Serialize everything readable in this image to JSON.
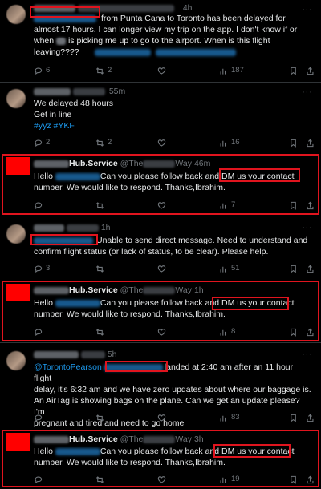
{
  "tweets": [
    {
      "time": "4h",
      "text": "from Punta Cana to Toronto has been delayed for almost 17 hours. I can longer view my trip on the app. I don't know if or when I is picking me up to go to the airport. When is this flight leaving????",
      "line1": "from Punta Cana to Toronto has been delayed for",
      "line2": "almost 17 hours. I can longer view my trip on the app. I don't know if or",
      "line3a": "when",
      "line3b": "is picking me up to go to the airport. When is this flight",
      "line4": "leaving????",
      "replies": "6",
      "reposts": "2",
      "likes": "",
      "views": "187"
    },
    {
      "time": "55m",
      "line1": "We delayed 48 hours",
      "line2": "Get in line",
      "hashtags": "#yyz #YKF",
      "replies": "2",
      "reposts": "2",
      "likes": "",
      "views": "16"
    },
    {
      "name": "Hub.Service",
      "handle": "@The",
      "handle2": "Way",
      "time": "46m",
      "hello": "Hello",
      "line1a": "Can you please follow back and",
      "dm": "DM us your contact",
      "line2": "number, We would like to respond. Thanks,Ibrahim.",
      "replies": "",
      "reposts": "",
      "likes": "",
      "views": "7"
    },
    {
      "time": "1h",
      "line1": "Unable to send direct message. Need to understand and",
      "line2": "confirm flight status (or lack of status, to be clear). Please help.",
      "replies": "3",
      "reposts": "",
      "likes": "",
      "views": "51"
    },
    {
      "name": "Hub.Service",
      "handle": "@The",
      "handle2": "Way",
      "time": "1h",
      "hello": "Hello",
      "line1a": "Can you please follow back and",
      "dm": "DM us your contact",
      "line2": "number, We would like to respond. Thanks,Ibrahim.",
      "replies": "",
      "reposts": "",
      "likes": "",
      "views": "8"
    },
    {
      "time": "5h",
      "mention": "@TorontoPearson",
      "line1b": "landed at 2:40 am after an 11 hour flight",
      "line2": "delay, it's 6:32 am and we have zero updates about where our baggage is.",
      "line3": "An AirTag is showing bags on the plane. Can we get an update please? I'm",
      "line4": "pregnant and tired and need to go home",
      "replies": "",
      "reposts": "",
      "likes": "",
      "views": "83"
    },
    {
      "name": "Hub.Service",
      "handle": "@The",
      "handle2": "Way",
      "time": "3h",
      "hello": "Hello",
      "line1a": "Can you please follow back and",
      "dm": "DM us your contact",
      "line2": "number, We would like to respond. Thanks,Ibrahim.",
      "replies": "",
      "reposts": "",
      "likes": "",
      "views": "19"
    }
  ],
  "icons": {
    "reply": "reply-icon",
    "repost": "repost-icon",
    "like": "heart-icon",
    "views": "views-icon",
    "share": "share-icon",
    "more": "more-icon"
  },
  "colors": {
    "background": "#000000",
    "text": "#e7e9ea",
    "muted": "#71767b",
    "link": "#1d9bf0",
    "highlight": "#e0141e"
  }
}
